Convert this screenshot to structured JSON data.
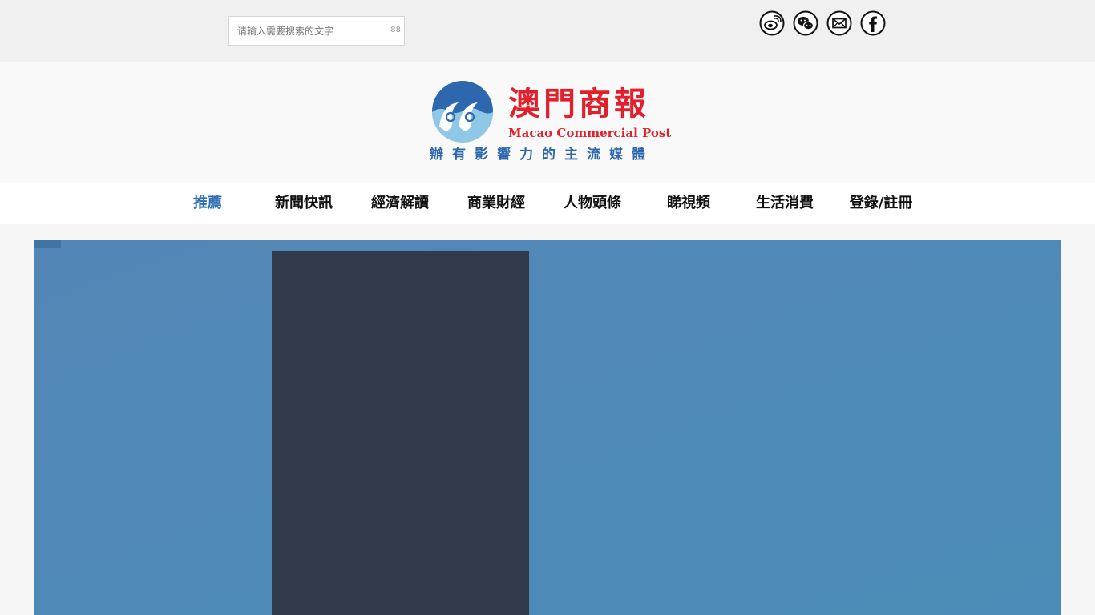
{
  "search": {
    "placeholder": "请输入需要搜索的文字",
    "button_label": "88"
  },
  "social": [
    {
      "name": "weibo-icon"
    },
    {
      "name": "wechat-icon"
    },
    {
      "name": "email-icon"
    },
    {
      "name": "facebook-icon"
    }
  ],
  "logo": {
    "title_cn": "澳門商報",
    "title_en": "Macao Commercial Post",
    "slogan": "辦有影響力的主流媒體",
    "colors": {
      "red": "#e1202b",
      "blue": "#2d67ad",
      "light_blue": "#8ec8e6"
    }
  },
  "nav": {
    "items": [
      {
        "label": "推薦",
        "active": true
      },
      {
        "label": "新聞快訊",
        "active": false
      },
      {
        "label": "經濟解讀",
        "active": false
      },
      {
        "label": "商業財經",
        "active": false
      },
      {
        "label": "人物頭條",
        "active": false
      },
      {
        "label": "睇視頻",
        "active": false
      },
      {
        "label": "生活消費",
        "active": false
      },
      {
        "label": "登錄/註冊",
        "active": false
      }
    ],
    "active_color": "#2f6db5"
  },
  "banner": {
    "background_color": "#4f89b8",
    "panel_color": "#313b4b"
  }
}
